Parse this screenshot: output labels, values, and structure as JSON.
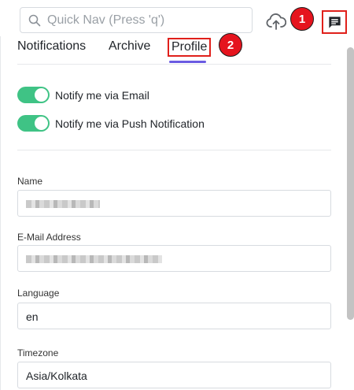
{
  "topbar": {
    "search_placeholder": "Quick Nav (Press 'q')",
    "search_icon": "search-icon",
    "upload_icon": "cloud-upload-icon",
    "chat_icon": "message-icon"
  },
  "annotations": {
    "badge1": "1",
    "badge2": "2",
    "badge_color": "#e5141e",
    "highlight_color": "#e0201b"
  },
  "tabs": [
    {
      "label": "Notifications"
    },
    {
      "label": "Archive"
    },
    {
      "label": "Profile",
      "active": true
    }
  ],
  "accent_color": "#6a5be2",
  "toggle_color": "#3fc385",
  "toggles": {
    "email": {
      "label": "Notify me via Email",
      "on": true
    },
    "push": {
      "label": "Notify me via Push Notification",
      "on": true
    }
  },
  "fields": {
    "name": {
      "label": "Name"
    },
    "email": {
      "label": "E-Mail Address"
    },
    "language": {
      "label": "Language",
      "value": "en"
    },
    "timezone": {
      "label": "Timezone",
      "value": "Asia/Kolkata"
    }
  }
}
